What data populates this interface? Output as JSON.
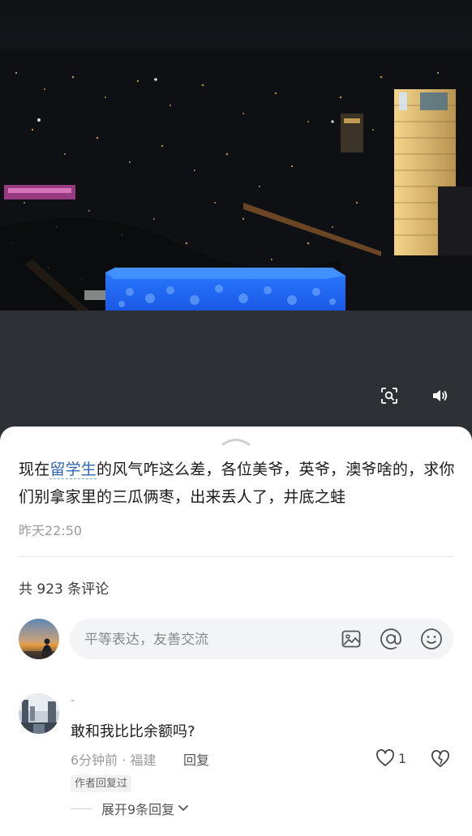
{
  "video": {
    "scan_icon": "scan-icon",
    "sound_icon": "speaker-icon"
  },
  "post": {
    "text_before": "现在",
    "keyword": "留学生",
    "text_after": "的风气咋这么差，各位美爷，英爷，澳爷啥的，求你们别拿家里的三瓜俩枣，出来丢人了，井底之蛙",
    "time": "昨天22:50"
  },
  "comments": {
    "count_label": "共 923 条评论",
    "input_placeholder": "平等表达，友善交流",
    "input_icons": [
      "image-icon",
      "at-icon",
      "emoji-icon"
    ],
    "items": [
      {
        "username": "-",
        "text": "敢和我比比余额吗?",
        "meta": "6分钟前 · 福建",
        "reply_label": "回复",
        "likes": "1",
        "badge": "作者回复过",
        "expand_label": "展开9条回复"
      }
    ]
  },
  "colors": {
    "sheet_bg": "#ffffff",
    "keyword": "#2f65b4",
    "muted": "#9b9b9b",
    "video_bg": "#2d3035"
  }
}
